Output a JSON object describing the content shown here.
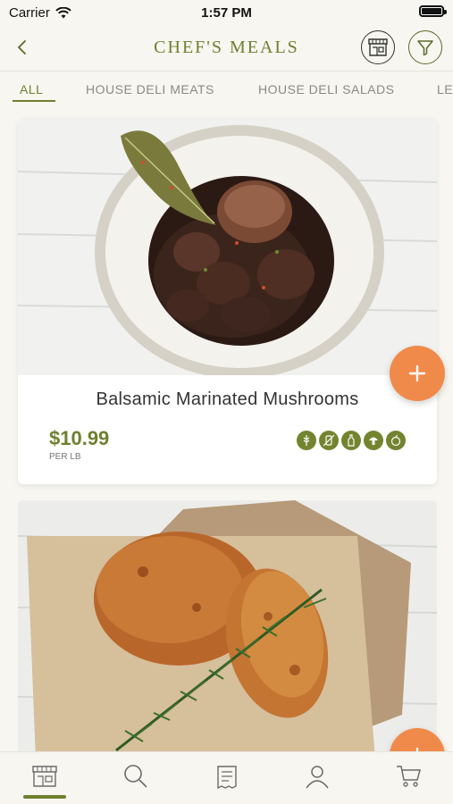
{
  "status_bar": {
    "carrier": "Carrier",
    "time": "1:57 PM"
  },
  "header": {
    "title": "CHEF'S MEALS",
    "back_icon": "chevron-left-icon",
    "store_icon": "store-icon",
    "filter_icon": "filter-icon"
  },
  "categories": {
    "selected": "ALL",
    "items": [
      {
        "label": "ALL"
      },
      {
        "label": "HOUSE DELI MEATS"
      },
      {
        "label": "HOUSE DELI SALADS"
      },
      {
        "label": "LE"
      }
    ]
  },
  "products": [
    {
      "name": "Balsamic Marinated Mushrooms",
      "price": "$10.99",
      "unit": "PER LB",
      "image": "balsamic-mushrooms-photo",
      "diet_icons": [
        "wheat-free-icon",
        "dairy-free-icon",
        "bottle-icon",
        "mushroom-icon",
        "apple-icon"
      ]
    },
    {
      "name": "",
      "image": "fried-chicken-photo"
    }
  ],
  "colors": {
    "brand": "#6f7f2f",
    "accent": "#f08a4b",
    "background": "#f7f6f0"
  },
  "bottom_nav": [
    {
      "icon": "store-icon",
      "active": true
    },
    {
      "icon": "search-icon"
    },
    {
      "icon": "list-icon"
    },
    {
      "icon": "profile-icon"
    },
    {
      "icon": "cart-icon"
    }
  ]
}
